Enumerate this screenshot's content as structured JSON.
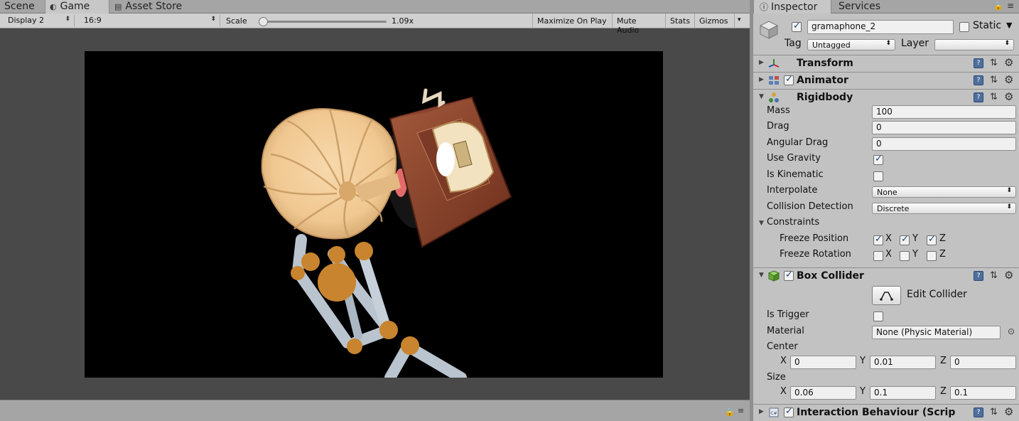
{
  "game_tabs": [
    {
      "label": "Scene",
      "icon": "scene-icon"
    },
    {
      "label": "Game",
      "icon": "game-controller-icon"
    },
    {
      "label": "Asset Store",
      "icon": "store-icon"
    }
  ],
  "toolbar": {
    "display": "Display 2",
    "aspect": "16:9",
    "scale_label": "Scale",
    "scale_value": "1.09x",
    "maximize": "Maximize On Play",
    "mute": "Mute Audio",
    "stats": "Stats",
    "gizmos": "Gizmos"
  },
  "inspector_tabs": [
    {
      "label": "Inspector",
      "icon": "info-icon"
    },
    {
      "label": "Services",
      "icon": ""
    }
  ],
  "object": {
    "name": "gramaphone_2",
    "active": true,
    "static_label": "Static",
    "static": false,
    "tag_label": "Tag",
    "tag": "Untagged",
    "layer_label": "Layer",
    "layer": ""
  },
  "components": {
    "transform": {
      "title": "Transform"
    },
    "animator": {
      "title": "Animator",
      "enabled": true
    },
    "rigidbody": {
      "title": "Rigidbody",
      "mass_label": "Mass",
      "mass": "100",
      "drag_label": "Drag",
      "drag": "0",
      "angular_drag_label": "Angular Drag",
      "angular_drag": "0",
      "use_gravity_label": "Use Gravity",
      "use_gravity": true,
      "is_kinematic_label": "Is Kinematic",
      "is_kinematic": false,
      "interpolate_label": "Interpolate",
      "interpolate": "None",
      "collision_label": "Collision Detection",
      "collision": "Discrete",
      "constraints_label": "Constraints",
      "freeze_position_label": "Freeze Position",
      "freeze_rotation_label": "Freeze Rotation",
      "axis_x": "X",
      "axis_y": "Y",
      "axis_z": "Z",
      "freeze_position": [
        true,
        true,
        true
      ],
      "freeze_rotation": [
        false,
        false,
        false
      ]
    },
    "box_collider": {
      "title": "Box Collider",
      "enabled": true,
      "edit_label": "Edit Collider",
      "is_trigger_label": "Is Trigger",
      "is_trigger": false,
      "material_label": "Material",
      "material": "None (Physic Material)",
      "center_label": "Center",
      "center": {
        "x": "0",
        "y": "0.01",
        "z": "0"
      },
      "size_label": "Size",
      "size": {
        "x": "0.06",
        "y": "0.1",
        "z": "0.1"
      }
    },
    "interaction": {
      "title": "Interaction Behaviour (Scrip",
      "enabled": true
    }
  },
  "colors": {
    "panel_bg": "#c2c2c2",
    "game_bg": "#494949",
    "viewport_bg": "#000000",
    "accent": "#1c3f7a"
  }
}
